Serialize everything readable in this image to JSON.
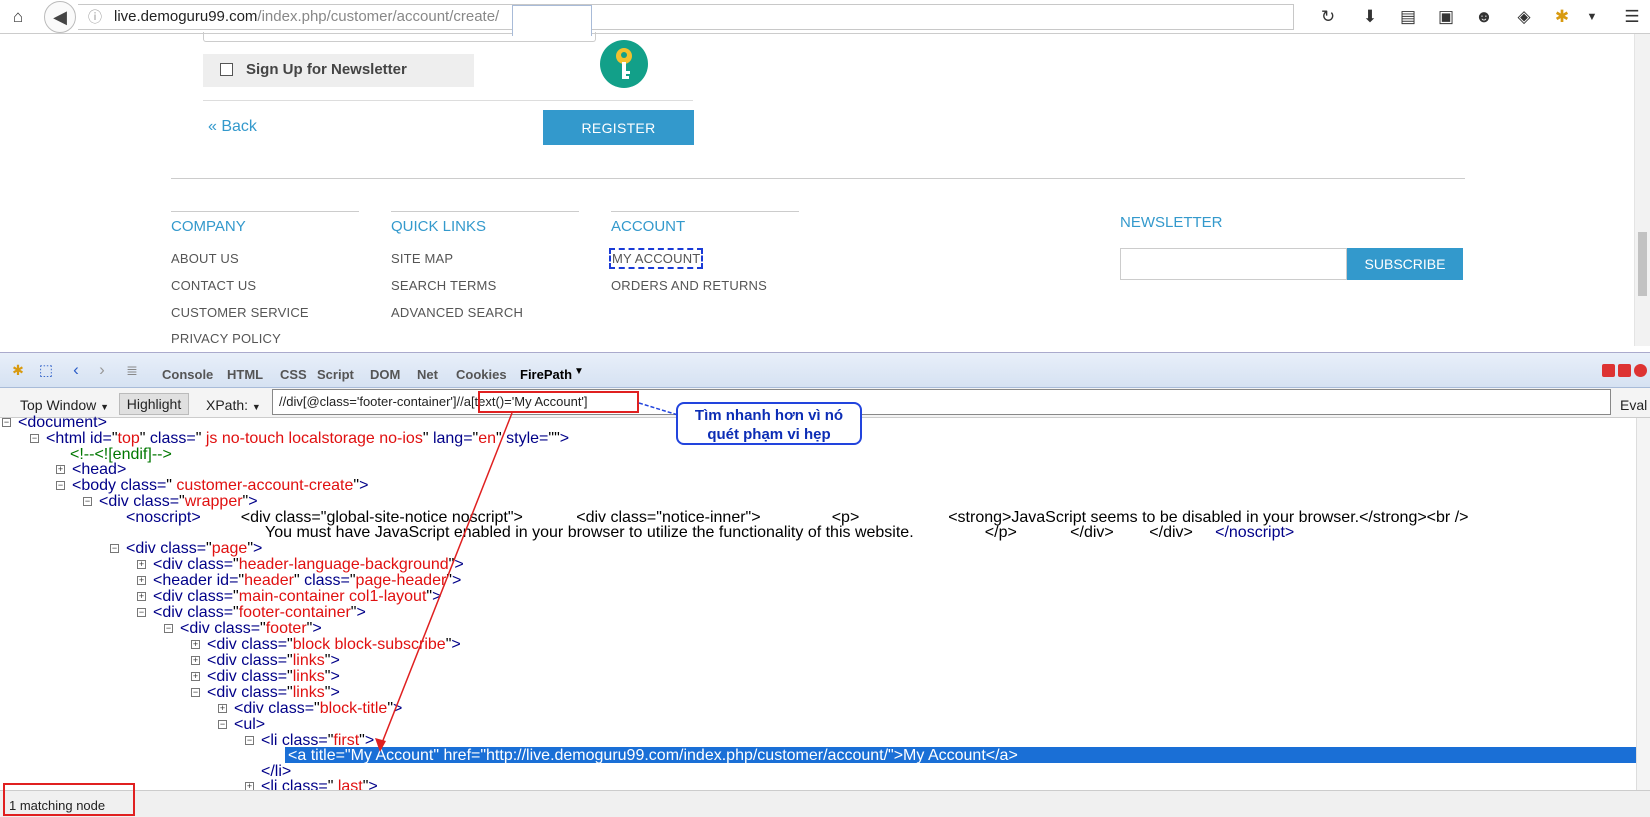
{
  "browser": {
    "url_host": "live.demoguru99.com",
    "url_path": "/index.php/customer/account/create/"
  },
  "form": {
    "newsletter_label": "Sign Up for Newsletter",
    "back_label": "« Back",
    "register_label": "REGISTER"
  },
  "footer": {
    "company": {
      "title": "COMPANY",
      "links": [
        "ABOUT US",
        "CONTACT US",
        "CUSTOMER SERVICE",
        "PRIVACY POLICY"
      ]
    },
    "quick_links": {
      "title": "QUICK LINKS",
      "links": [
        "SITE MAP",
        "SEARCH TERMS",
        "ADVANCED SEARCH"
      ]
    },
    "account": {
      "title": "ACCOUNT",
      "links": [
        "MY ACCOUNT",
        "ORDERS AND RETURNS"
      ]
    },
    "newsletter": {
      "title": "NEWSLETTER",
      "button": "SUBSCRIBE"
    }
  },
  "firebug": {
    "tabs": [
      "Console",
      "HTML",
      "CSS",
      "Script",
      "DOM",
      "Net",
      "Cookies"
    ],
    "active_tab": "FirePath",
    "window_select": "Top Window",
    "highlight_label": "Highlight",
    "xpath_label": "XPath:",
    "xpath_value": "//div[@class='footer-container']//a[text()='My Account']",
    "eval_label": "Eval",
    "callout": "Tìm nhanh hơn vì nó quét phạm vi hẹp",
    "status": "1 matching node"
  }
}
